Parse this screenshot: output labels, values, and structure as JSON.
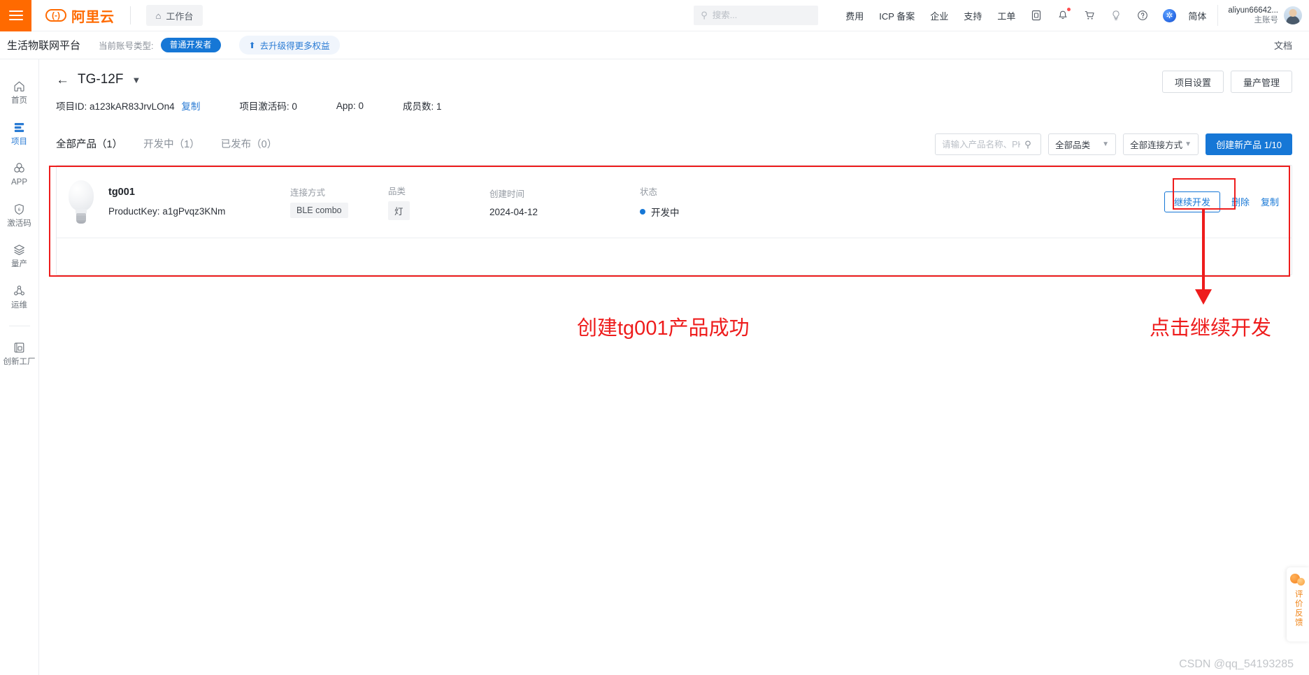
{
  "topbar": {
    "menu_icon": "hamburger-icon",
    "brand": "阿里云",
    "workbench": "工作台",
    "search_placeholder": "搜索...",
    "nav_links": [
      "费用",
      "ICP 备案",
      "企业",
      "支持",
      "工单"
    ],
    "icons": [
      "app-grid-icon",
      "bell-icon",
      "cart-icon",
      "bulb-icon",
      "help-icon",
      "globe-icon"
    ],
    "lang": "简体",
    "account_name": "aliyun66642...",
    "account_role": "主账号"
  },
  "subbar": {
    "platform_title": "生活物联网平台",
    "account_type_label": "当前账号类型:",
    "account_type_badge": "普通开发者",
    "upgrade_text": "去升级得更多权益",
    "docs": "文档"
  },
  "sidebar": {
    "items": [
      {
        "label": "首页",
        "icon": "home-icon",
        "active": false
      },
      {
        "label": "项目",
        "icon": "project-icon",
        "active": true
      },
      {
        "label": "APP",
        "icon": "app-icon",
        "active": false
      },
      {
        "label": "激活码",
        "icon": "activation-code-icon",
        "active": false
      },
      {
        "label": "量产",
        "icon": "mass-production-icon",
        "active": false
      },
      {
        "label": "运维",
        "icon": "operations-icon",
        "active": false
      },
      {
        "label": "创新工厂",
        "icon": "innovation-factory-icon",
        "active": false
      }
    ]
  },
  "project": {
    "name": "TG-12F",
    "back_icon": "back-arrow-icon",
    "dropdown_icon": "chevron-down-icon",
    "meta": {
      "id_label": "项目ID:",
      "id_value": "a123kAR83JrvLOn4",
      "copy": "复制",
      "activation_label": "项目激活码:",
      "activation_value": "0",
      "app_label": "App:",
      "app_value": "0",
      "members_label": "成员数:",
      "members_value": "1"
    },
    "buttons": {
      "settings": "项目设置",
      "mass_production": "量产管理"
    }
  },
  "toolbar": {
    "tabs": [
      {
        "label": "全部产品（1）",
        "active": true
      },
      {
        "label": "开发中（1）",
        "active": false
      },
      {
        "label": "已发布（0）",
        "active": false
      }
    ],
    "search_placeholder": "请输入产品名称、PK",
    "search_icon": "search-icon",
    "category_select": "全部品类",
    "connection_select": "全部连接方式",
    "create_button": "创建新产品 1/10"
  },
  "products": [
    {
      "icon": "light-bulb-icon",
      "name": "tg001",
      "product_key_label": "ProductKey:",
      "product_key_value": "a1gPvqz3KNm",
      "connection_label": "连接方式",
      "connection_value": "BLE combo",
      "category_label": "品类",
      "category_value": "灯",
      "created_label": "创建时间",
      "created_value": "2024-04-12",
      "status_label": "状态",
      "status_value": "开发中",
      "status_color": "#1677d6",
      "actions": {
        "continue": "继续开发",
        "delete": "删除",
        "copy": "复制"
      }
    }
  ],
  "annotations": {
    "color": "#ee1c1c",
    "left_text": "创建tg001产品成功",
    "right_text": "点击继续开发"
  },
  "feedback": {
    "text": "评价反馈",
    "icon": "feedback-bubble-icon"
  },
  "watermark": "CSDN @qq_54193285"
}
